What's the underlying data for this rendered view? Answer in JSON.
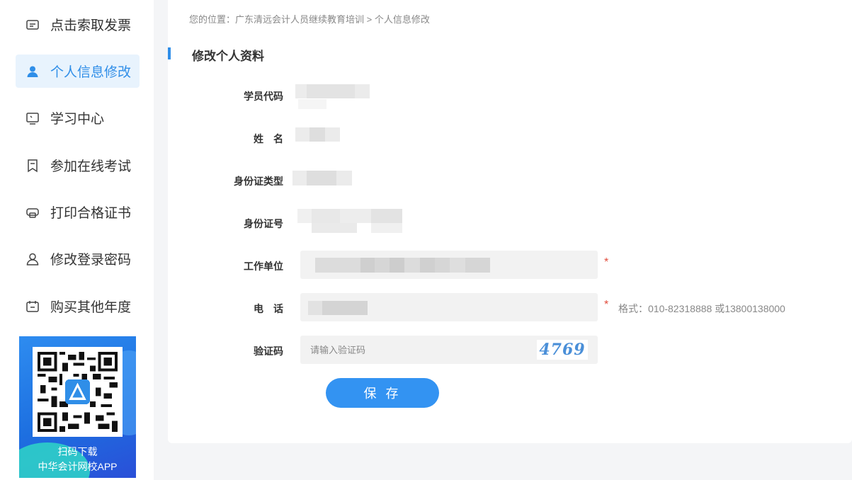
{
  "sidebar": {
    "items": [
      {
        "label": "点击索取发票",
        "icon": "invoice-icon",
        "active": false
      },
      {
        "label": "个人信息修改",
        "icon": "user-icon",
        "active": true
      },
      {
        "label": "学习中心",
        "icon": "monitor-icon",
        "active": false
      },
      {
        "label": "参加在线考试",
        "icon": "exam-icon",
        "active": false
      },
      {
        "label": "打印合格证书",
        "icon": "printer-icon",
        "active": false
      },
      {
        "label": "修改登录密码",
        "icon": "user-icon",
        "active": false
      },
      {
        "label": "购买其他年度",
        "icon": "cart-icon",
        "active": false
      }
    ],
    "promo": {
      "line1": "扫码下载",
      "line2": "中华会计网校APP"
    }
  },
  "breadcrumb": "您的位置：广东清远会计人员继续教育培训 > 个人信息修改",
  "page_title": "修改个人资料",
  "form": {
    "student_code_label": "学员代码",
    "name_label": "姓　名",
    "id_type_label": "身份证类型",
    "id_number_label": "身份证号",
    "workplace_label": "工作单位",
    "phone_label": "电　话",
    "captcha_label": "验证码",
    "required_mark": "*",
    "phone_hint": "格式：010-82318888 或13800138000",
    "captcha_placeholder": "请输入验证码",
    "captcha_code": "4769",
    "save_label": "保 存"
  },
  "colors": {
    "accent": "#2f8ee8",
    "button": "#3393f2",
    "required": "#e14c3c"
  }
}
